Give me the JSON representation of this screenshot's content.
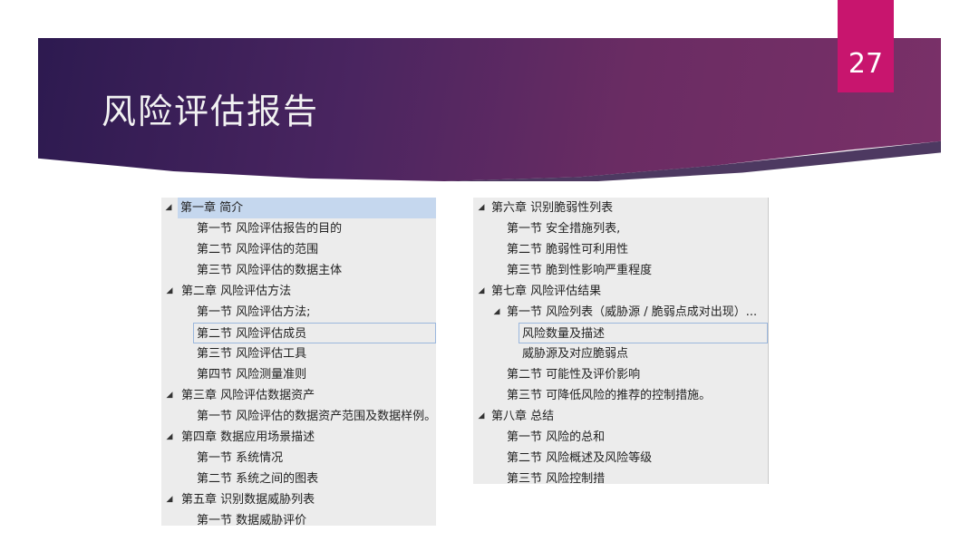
{
  "slide": {
    "title": "风险评估报告",
    "page_number": "27"
  },
  "left_tree": [
    {
      "level": 0,
      "expanded": true,
      "label": "第一章   简介",
      "selected": true
    },
    {
      "level": 1,
      "label": "第一节   风险评估报告的目的"
    },
    {
      "level": 1,
      "label": "第二节   风险评估的范围"
    },
    {
      "level": 1,
      "label": "第三节   风险评估的数据主体"
    },
    {
      "level": 0,
      "expanded": true,
      "label": "第二章   风险评估方法"
    },
    {
      "level": 1,
      "label": "第一节   风险评估方法;"
    },
    {
      "level": 1,
      "label": "第二节   风险评估成员",
      "focused": true
    },
    {
      "level": 1,
      "label": "第三节   风险评估工具"
    },
    {
      "level": 1,
      "label": "第四节   风险测量准则"
    },
    {
      "level": 0,
      "expanded": true,
      "label": "第三章   风险评估数据资产"
    },
    {
      "level": 1,
      "label": "第一节   风险评估的数据资产范围及数据样例。"
    },
    {
      "level": 0,
      "expanded": true,
      "label": "第四章   数据应用场景描述"
    },
    {
      "level": 1,
      "label": "第一节   系统情况"
    },
    {
      "level": 1,
      "label": "第二节   系统之间的图表"
    },
    {
      "level": 0,
      "expanded": true,
      "label": "第五章   识别数据威胁列表"
    },
    {
      "level": 1,
      "label": "第一节   数据威胁评价"
    }
  ],
  "right_tree": [
    {
      "level": 0,
      "expanded": true,
      "label": "第六章   识别脆弱性列表"
    },
    {
      "level": 1,
      "label": "第一节   安全措施列表,"
    },
    {
      "level": 1,
      "label": "第二节   脆弱性可利用性"
    },
    {
      "level": 1,
      "label": "第三节   脆到性影响严重程度"
    },
    {
      "level": 0,
      "expanded": true,
      "label": "第七章   风险评估结果"
    },
    {
      "level": 1,
      "expanded": true,
      "label": "第一节   风险列表（威胁源 / 脆弱点成对出现）..."
    },
    {
      "level": 2,
      "label": "风险数量及描述",
      "focused": true
    },
    {
      "level": 2,
      "label": "威胁源及对应脆弱点"
    },
    {
      "level": 1,
      "label": "第二节   可能性及评价影响"
    },
    {
      "level": 1,
      "label": "第三节   可降低风险的推荐的控制措施。"
    },
    {
      "level": 0,
      "expanded": true,
      "label": "第八章   总结"
    },
    {
      "level": 1,
      "label": "第一节   风险的总和"
    },
    {
      "level": 1,
      "label": "第二节   风险概述及风险等级"
    },
    {
      "level": 1,
      "label": "第三节   风险控制措"
    }
  ],
  "icons": {
    "expanded": "◢"
  },
  "colors": {
    "accent": "#c8156e",
    "header_dark": "#2d1a50",
    "header_light": "#7a3068",
    "selection": "#c5d7ee"
  }
}
